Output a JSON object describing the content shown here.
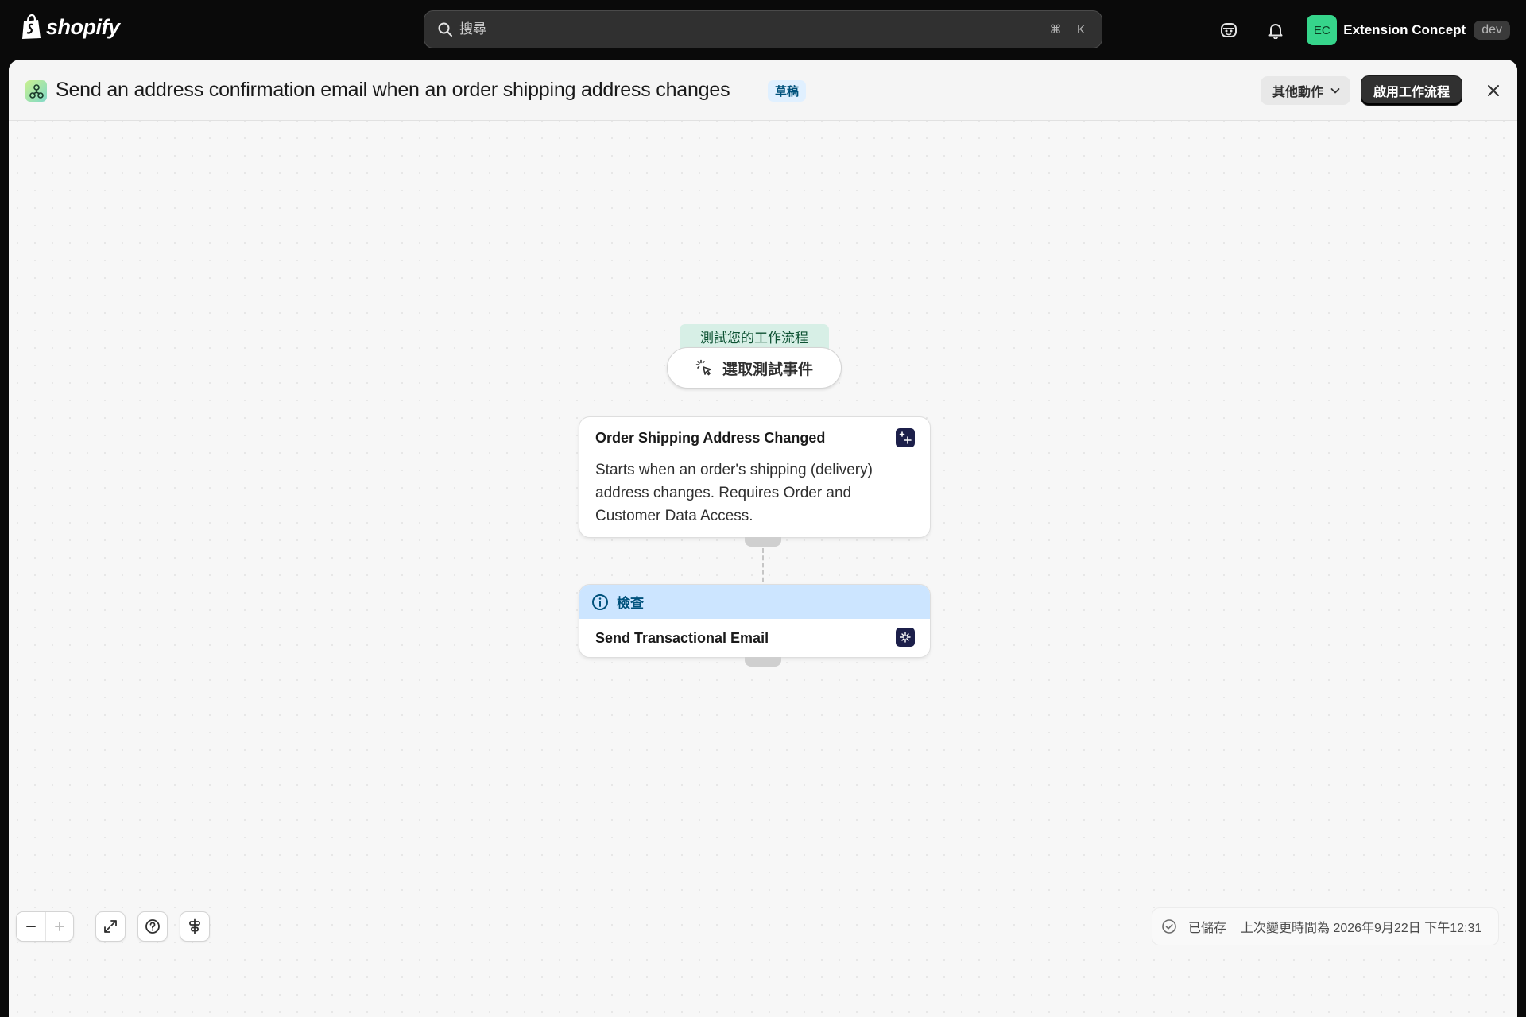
{
  "topbar": {
    "logo_text": "shopify",
    "search": {
      "placeholder": "搜尋",
      "shortcut_key1": "⌘",
      "shortcut_key2": "K"
    },
    "store": {
      "avatar_initials": "EC",
      "name": "Extension Concept",
      "badge": "dev"
    }
  },
  "header": {
    "title": "Send an address confirmation email when an order shipping address changes",
    "status_badge": "草稿",
    "more_actions_label": "其他動作",
    "activate_label": "啟用工作流程"
  },
  "canvas": {
    "test_label": "測試您的工作流程",
    "test_button_label": "選取測試事件",
    "trigger": {
      "title": "Order Shipping Address Changed",
      "description": "Starts when an order's shipping (delivery) address changes. Requires Order and Customer Data Access."
    },
    "action": {
      "banner_label": "檢查",
      "title": "Send Transactional Email"
    }
  },
  "footer": {
    "saved_label": "已儲存",
    "last_modified": "上次變更時間為 2026年9月22日 下午12:31"
  },
  "colors": {
    "accent_green": "#36d58b",
    "banner_blue": "#cce5ff",
    "primary_button": "#303030"
  }
}
